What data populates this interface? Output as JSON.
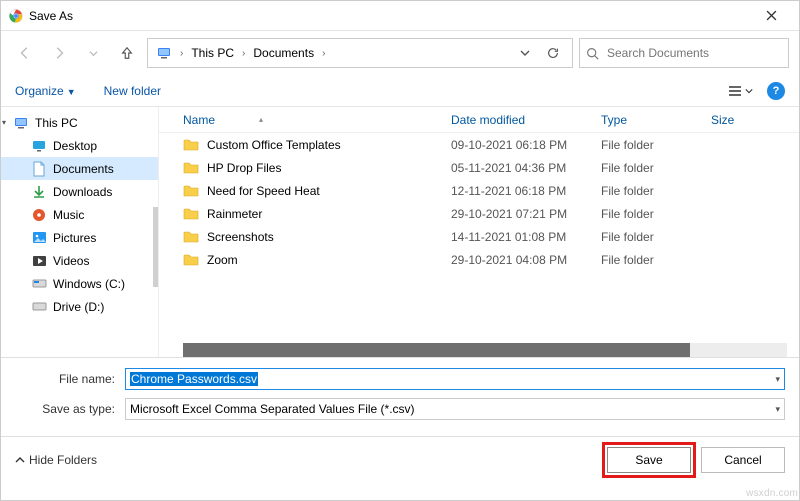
{
  "window": {
    "title": "Save As"
  },
  "breadcrumb": {
    "root": "This PC",
    "folder": "Documents"
  },
  "search": {
    "placeholder": "Search Documents"
  },
  "toolbar": {
    "organize": "Organize",
    "new_folder": "New folder"
  },
  "sidebar": {
    "this_pc": "This PC",
    "items": [
      {
        "label": "Desktop"
      },
      {
        "label": "Documents"
      },
      {
        "label": "Downloads"
      },
      {
        "label": "Music"
      },
      {
        "label": "Pictures"
      },
      {
        "label": "Videos"
      },
      {
        "label": "Windows (C:)"
      },
      {
        "label": "Drive (D:)"
      }
    ]
  },
  "columns": {
    "name": "Name",
    "date": "Date modified",
    "type": "Type",
    "size": "Size"
  },
  "files": [
    {
      "name": "Custom Office Templates",
      "date": "09-10-2021 06:18 PM",
      "type": "File folder"
    },
    {
      "name": "HP Drop Files",
      "date": "05-11-2021 04:36 PM",
      "type": "File folder"
    },
    {
      "name": "Need for Speed Heat",
      "date": "12-11-2021 06:18 PM",
      "type": "File folder"
    },
    {
      "name": "Rainmeter",
      "date": "29-10-2021 07:21 PM",
      "type": "File folder"
    },
    {
      "name": "Screenshots",
      "date": "14-11-2021 01:08 PM",
      "type": "File folder"
    },
    {
      "name": "Zoom",
      "date": "29-10-2021 04:08 PM",
      "type": "File folder"
    }
  ],
  "form": {
    "file_name_label": "File name:",
    "file_name_value": "Chrome Passwords.csv",
    "save_type_label": "Save as type:",
    "save_type_value": "Microsoft Excel Comma Separated Values File (*.csv)"
  },
  "footer": {
    "hide_folders": "Hide Folders",
    "save": "Save",
    "cancel": "Cancel"
  },
  "watermark": "wsxdn.com"
}
